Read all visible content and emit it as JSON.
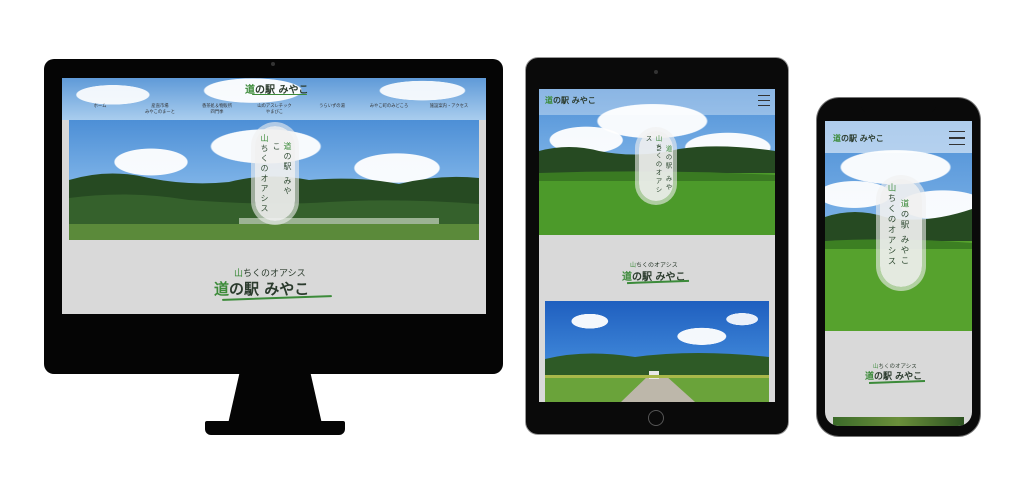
{
  "site": {
    "logo": {
      "prefix": "道",
      "rest": "の駅 みやこ"
    },
    "tagline": {
      "first": "山",
      "rest": "ちくのオアシス"
    }
  },
  "desktop": {
    "nav": [
      {
        "label": "ホーム"
      },
      {
        "label": "産直市場\nみやこのまーと"
      },
      {
        "label": "香茶処＆物販所\n四門季"
      },
      {
        "label": "山のアスレチック\nやまびこ"
      },
      {
        "label": "うらいずの湯"
      },
      {
        "label": "みやこ町のみどころ"
      },
      {
        "label": "施設案内・アクセス"
      }
    ]
  },
  "colors": {
    "accent_green": "#3c8b3a",
    "device_frame": "#050505",
    "page_gray": "#d9d9d9"
  }
}
